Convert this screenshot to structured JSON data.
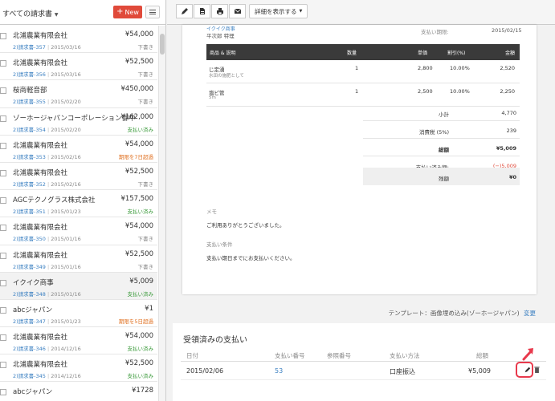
{
  "left_panel": {
    "filter_label": "すべての請求書",
    "new_button_label": "New",
    "invoices": [
      {
        "company": "北浦農業有限会社",
        "amount": "¥54,000",
        "number": "2)請求書-357",
        "date": "2015/03/16",
        "status": "下書き",
        "status_type": "draft"
      },
      {
        "company": "北浦農業有限会社",
        "amount": "¥52,500",
        "number": "2)請求書-356",
        "date": "2015/03/16",
        "status": "下書き",
        "status_type": "draft"
      },
      {
        "company": "桜商軽音部",
        "amount": "¥450,000",
        "number": "2)請求書-355",
        "date": "2015/02/20",
        "status": "下書き",
        "status_type": "draft"
      },
      {
        "company": "ゾーホージャパンコーポレーション御中",
        "amount": "¥162,000",
        "number": "2)請求書-354",
        "date": "2015/02/20",
        "status": "支払い済み",
        "status_type": "paid"
      },
      {
        "company": "北浦農業有限会社",
        "amount": "¥54,000",
        "number": "2)請求書-353",
        "date": "2015/02/16",
        "status": "期限を7日超過",
        "status_type": "overdue"
      },
      {
        "company": "北浦農業有限会社",
        "amount": "¥52,500",
        "number": "2)請求書-352",
        "date": "2015/02/16",
        "status": "下書き",
        "status_type": "draft"
      },
      {
        "company": "AGCテクノグラス株式会社",
        "amount": "¥157,500",
        "number": "2)請求書-351",
        "date": "2015/01/23",
        "status": "支払い済み",
        "status_type": "paid"
      },
      {
        "company": "北浦農業有限会社",
        "amount": "¥54,000",
        "number": "2)請求書-350",
        "date": "2015/01/16",
        "status": "下書き",
        "status_type": "draft"
      },
      {
        "company": "北浦農業有限会社",
        "amount": "¥52,500",
        "number": "2)請求書-349",
        "date": "2015/01/16",
        "status": "下書き",
        "status_type": "draft"
      },
      {
        "company": "イクイク商事",
        "amount": "¥5,009",
        "number": "2)請求書-348",
        "date": "2015/01/16",
        "status": "支払い済み",
        "status_type": "paid",
        "selected": true
      },
      {
        "company": "abcジャパン",
        "amount": "¥1",
        "number": "2)請求書-347",
        "date": "2015/01/23",
        "status": "期限を5日超過",
        "status_type": "overdue"
      },
      {
        "company": "北浦農業有限会社",
        "amount": "¥54,000",
        "number": "2)請求書-346",
        "date": "2014/12/16",
        "status": "支払い済み",
        "status_type": "paid"
      },
      {
        "company": "北浦農業有限会社",
        "amount": "¥52,500",
        "number": "2)請求書-345",
        "date": "2014/12/16",
        "status": "支払い済み",
        "status_type": "paid"
      },
      {
        "company": "abcジャパン",
        "amount": "¥1728",
        "number": "",
        "date": "",
        "status": "",
        "status_type": "draft"
      }
    ]
  },
  "toolbar": {
    "icons": [
      "edit-icon",
      "pdf-icon",
      "print-icon",
      "mail-icon"
    ],
    "detail_label": "詳細を表示する"
  },
  "invoice_doc": {
    "top_link": "イクイク商事",
    "top_name": "平次郎 特理",
    "due_label": "支払い期限:",
    "due_value": "2015/02/15",
    "columns": {
      "item": "商品 & 説明",
      "qty": "数量",
      "rate": "単価",
      "discount": "割引(%)",
      "amount": "金額"
    },
    "items": [
      {
        "name": "じ定湧",
        "sub": "水田の施肥として",
        "qty": "1",
        "rate": "2,800",
        "discount": "10.00%",
        "amount": "2,520"
      },
      {
        "name": "塩ビ管",
        "sub": "5m",
        "qty": "1",
        "rate": "2,500",
        "discount": "10.00%",
        "amount": "2,250"
      }
    ],
    "totals": [
      {
        "label": "小計",
        "value": "4,770"
      },
      {
        "label": "消費税 (5%)",
        "value": "239"
      },
      {
        "label": "総額",
        "value": "¥5,009"
      },
      {
        "label": "支払い済み額:",
        "value": "(−)5,009"
      },
      {
        "label": "残額",
        "value": "¥0"
      }
    ],
    "memo_label": "メモ",
    "memo_text": "ご利用ありがとうございました。",
    "terms_label": "支払い条件",
    "terms_text": "支払い期日までにお支払いください。"
  },
  "template": {
    "text": "テンプレート：画像埋め込み(ゾーホージャパン)",
    "change_label": "変更"
  },
  "payments": {
    "title": "受領済みの支払い",
    "columns": {
      "date": "日付",
      "payment_no": "支払い番号",
      "reference": "参照番号",
      "method": "支払い方法",
      "amount": "総額"
    },
    "rows": [
      {
        "date": "2015/02/06",
        "payment_no": "53",
        "reference": "",
        "method": "口座振込",
        "amount": "¥5,009"
      }
    ]
  },
  "colors": {
    "accent_red": "#e04a3a",
    "link_blue": "#3a7fc1",
    "paid_green": "#3a9a3a",
    "overdue_orange": "#e07020",
    "highlight_pink": "#e8394c"
  }
}
